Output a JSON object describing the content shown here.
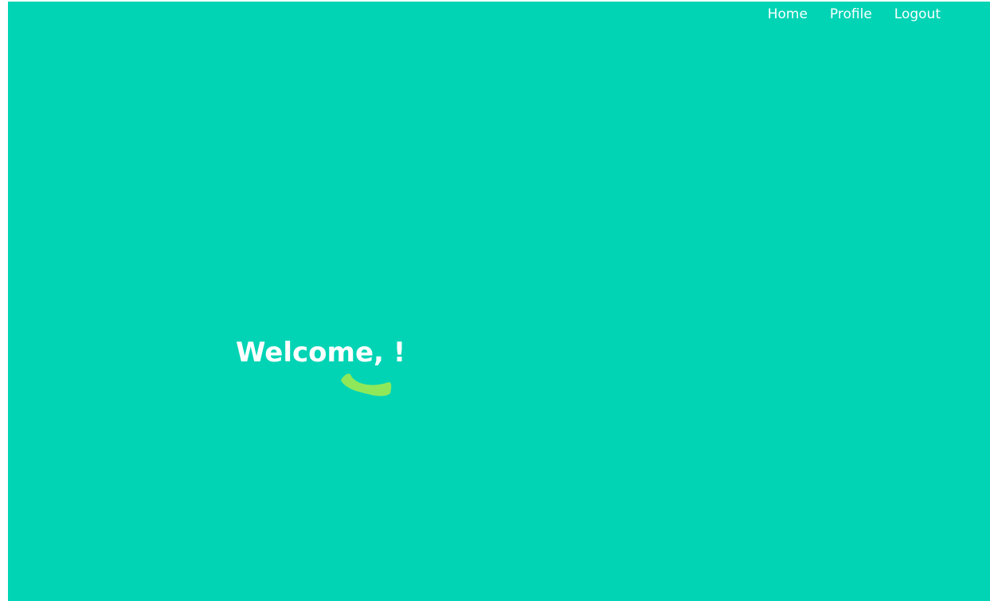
{
  "nav": {
    "items": [
      {
        "label": "Home"
      },
      {
        "label": "Profile"
      },
      {
        "label": "Logout"
      }
    ]
  },
  "hero": {
    "greeting": "Welcome, !"
  },
  "colors": {
    "background": "#00d4b5",
    "text": "#ffffff",
    "brush_accent": "#8fe85a"
  }
}
